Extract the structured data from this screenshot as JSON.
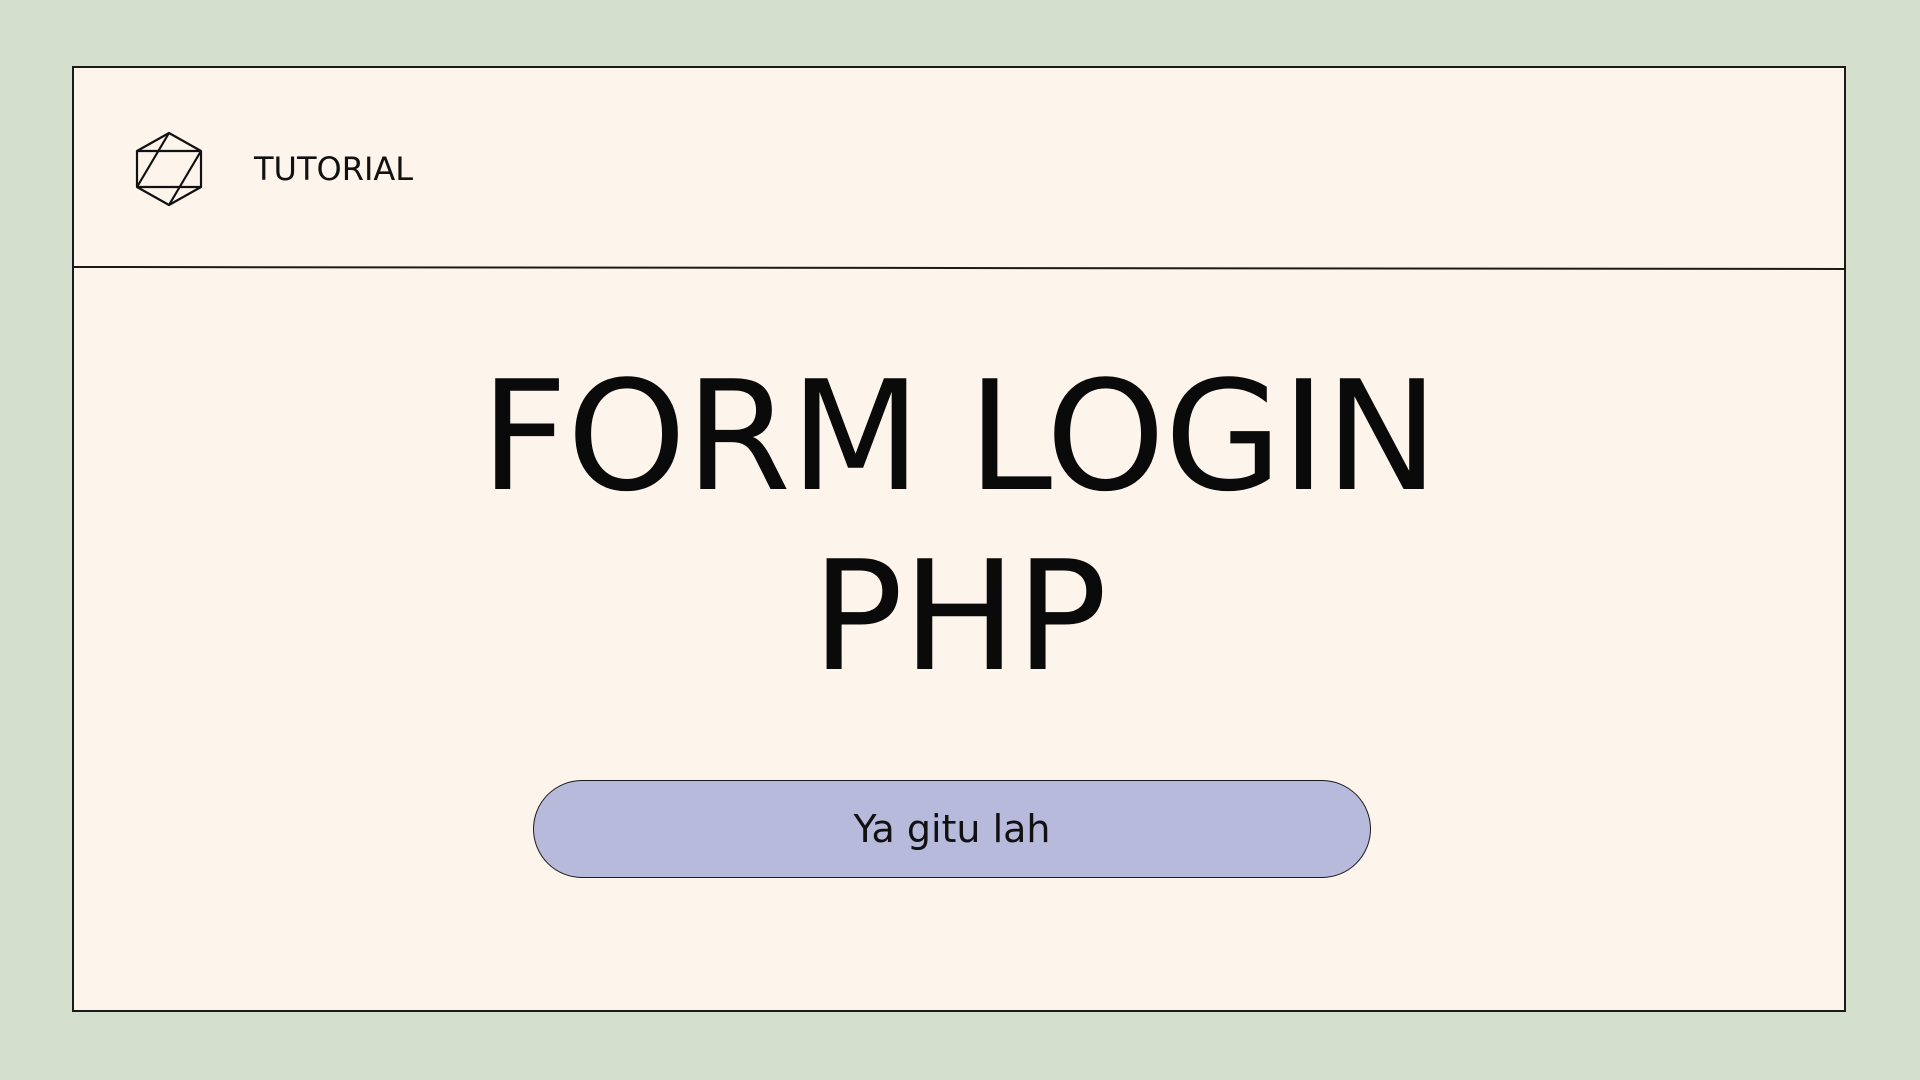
{
  "header": {
    "logo_icon": "geometric-hexagon-icon",
    "label": "TUTORIAL"
  },
  "title": {
    "line1": "FORM LOGIN",
    "line2": "PHP"
  },
  "pill": {
    "label": "Ya gitu lah"
  },
  "colors": {
    "background": "#d5dfcd",
    "card": "#fdf4ec",
    "pill": "#b8badc",
    "ink": "#0a0a0a"
  }
}
